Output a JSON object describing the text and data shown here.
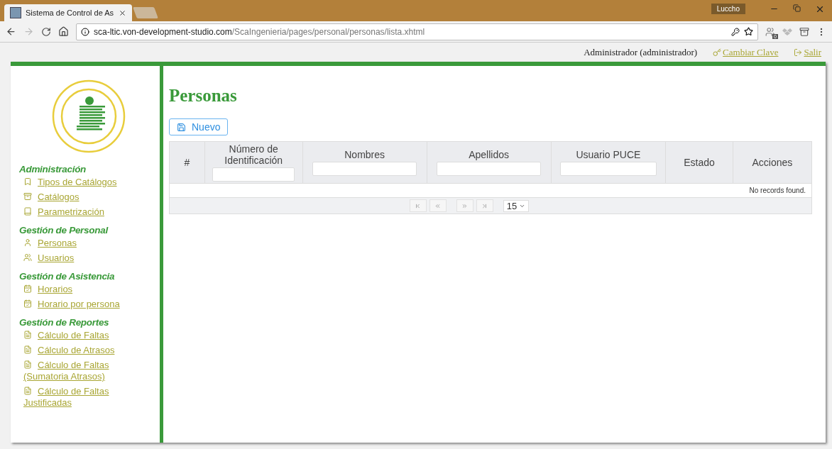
{
  "browser": {
    "tab_title": "Sistema de Control de As",
    "profile": "Luccho",
    "url_host": "sca-ltic.von-development-studio.com",
    "url_path": "/ScaIngenieria/pages/personal/personas/lista.xhtml",
    "extension_badge": "0"
  },
  "user_bar": {
    "user": "Administrador (administrador)",
    "links": [
      "Cambiar Clave",
      "Salir"
    ]
  },
  "sidebar": {
    "sections": [
      {
        "title": "Administración",
        "items": [
          {
            "label": "Tipos de Catálogos",
            "kind": "bookmark"
          },
          {
            "label": "Catálogos",
            "kind": "archive"
          },
          {
            "label": "Parametrización",
            "kind": "book"
          }
        ]
      },
      {
        "title": "Gestión de Personal",
        "items": [
          {
            "label": "Personas",
            "kind": "person"
          },
          {
            "label": "Usuarios",
            "kind": "users"
          }
        ]
      },
      {
        "title": "Gestión de Asistencia",
        "items": [
          {
            "label": "Horarios",
            "kind": "calendar"
          },
          {
            "label": "Horario por persona",
            "kind": "calendar"
          }
        ]
      },
      {
        "title": "Gestión de Reportes",
        "items": [
          {
            "label": "Cálculo de Faltas",
            "kind": "pdf"
          },
          {
            "label": "Cálculo de Atrasos",
            "kind": "pdf"
          },
          {
            "label": "Cálculo de Faltas (Sumatoria Atrasos)",
            "kind": "pdf"
          },
          {
            "label": "Cálculo de Faltas Justificadas",
            "kind": "pdf"
          }
        ]
      }
    ]
  },
  "page": {
    "title": "Personas",
    "new_button": "Nuevo"
  },
  "table": {
    "columns": [
      {
        "label": "#",
        "filter": false
      },
      {
        "label": "Número de Identificación",
        "filter": true
      },
      {
        "label": "Nombres",
        "filter": true
      },
      {
        "label": "Apellidos",
        "filter": true
      },
      {
        "label": "Usuario PUCE",
        "filter": true
      },
      {
        "label": "Estado",
        "filter": false
      },
      {
        "label": "Acciones",
        "filter": false
      }
    ],
    "empty_message": "No records found.",
    "rows_per_page": "15"
  }
}
